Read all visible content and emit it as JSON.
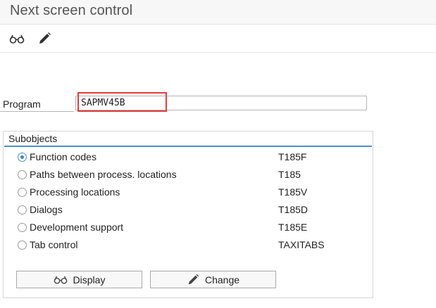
{
  "window": {
    "title": "Next screen control"
  },
  "toolbar": {
    "display_icon": "glasses-icon",
    "change_icon": "pencil-icon"
  },
  "program": {
    "label": "Program",
    "value": "SAPMV45B"
  },
  "subobjects": {
    "title": "Subobjects",
    "selected_index": 0,
    "items": [
      {
        "label": "Function codes",
        "code": "T185F"
      },
      {
        "label": "Paths between process. locations",
        "code": "T185"
      },
      {
        "label": "Processing locations",
        "code": "T185V"
      },
      {
        "label": "Dialogs",
        "code": "T185D"
      },
      {
        "label": "Development support",
        "code": "T185E"
      },
      {
        "label": "Tab control",
        "code": "TAXITABS"
      }
    ]
  },
  "buttons": {
    "display_label": "Display",
    "change_label": "Change"
  },
  "colors": {
    "highlight": "#e03c3c",
    "accent": "#4a90c8"
  }
}
